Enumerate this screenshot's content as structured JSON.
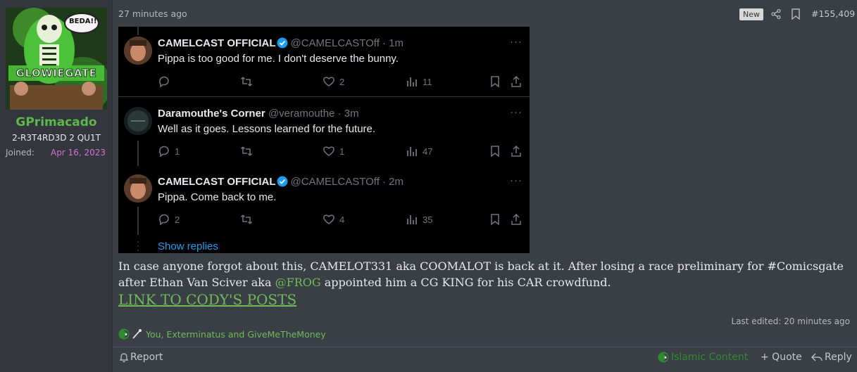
{
  "user": {
    "name": "GPrimacado",
    "title": "2-R3T4RD3D 2 QU1T",
    "joined_label": "Joined:",
    "joined_date": "Apr 16, 2023",
    "avatar_text_top": "BEDA!!",
    "avatar_text_mid": "GLOWIEGATE"
  },
  "post": {
    "time": "27 minutes ago",
    "new_badge": "New",
    "number": "#155,409",
    "body_part1": "In case anyone forgot about this, CAMELOT331 aka COOMALOT is back at it. After losing a race preliminary for #Comicsgate after Ethan Van Sciver aka ",
    "mention": "@FROG",
    "body_part2": " appointed him a CG KING for his CAR crowdfund.",
    "link_text": "LINK TO CODY'S POSTS",
    "last_edited": "Last edited: 20 minutes ago",
    "reactions_text": "You, Exterminatus and GiveMeTheMoney"
  },
  "tweets": [
    {
      "name": "CAMELCAST OFFICIAL",
      "handle": "@CAMELCASTOff · 1m",
      "text": "Pippa is too good for me. I don't deserve the bunny.",
      "replies": "",
      "likes": "2",
      "views": "11"
    },
    {
      "name": "Daramouthe's Corner",
      "handle": "@veramouthe · 3m",
      "text": "Well as it goes. Lessons learned for the future.",
      "replies": "1",
      "likes": "1",
      "views": "47"
    },
    {
      "name": "CAMELCAST OFFICIAL",
      "handle": "@CAMELCASTOff · 2m",
      "text": "Pippa. Come back to me.",
      "replies": "2",
      "likes": "4",
      "views": "35"
    }
  ],
  "show_replies": "Show replies",
  "tweet_more": "···",
  "footer": {
    "report": "Report",
    "islamic": "Islamic Content",
    "quote": "+ Quote",
    "reply": "Reply"
  },
  "colors": {
    "accent_green": "#6fba5a",
    "username_green": "#5cb84a",
    "joined_pink": "#d46fd4",
    "twitter_blue": "#1d9bf0"
  },
  "icons": {
    "share": "share-icon",
    "bookmark": "bookmark-icon",
    "reply": "reply-icon",
    "retweet": "retweet-icon",
    "like": "heart-icon",
    "views": "views-icon",
    "upload": "upload-icon",
    "verified": "verified-badge-icon"
  }
}
